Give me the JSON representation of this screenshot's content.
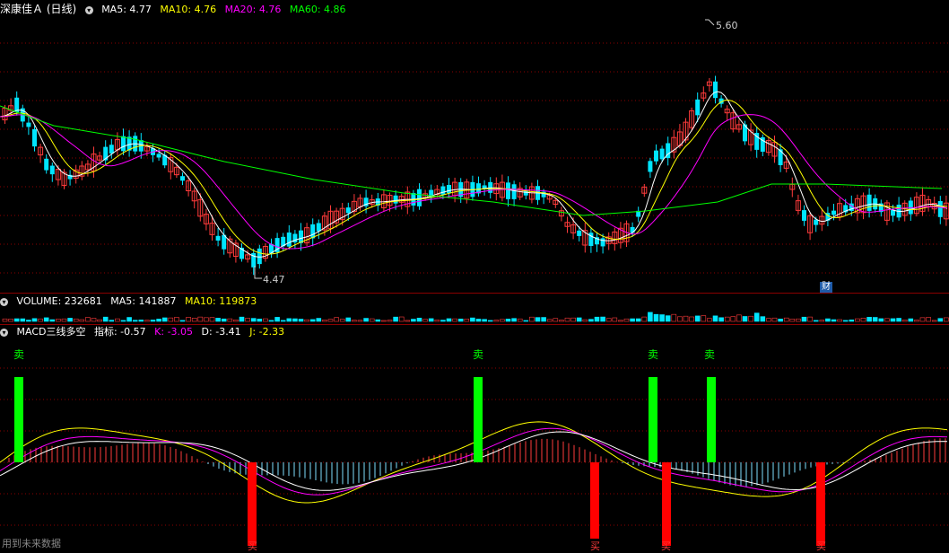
{
  "main_header": {
    "title": "深康佳Ａ (日线)",
    "ma5": "MA5: 4.77",
    "ma10": "MA10: 4.76",
    "ma20": "MA20: 4.76",
    "ma60": "MA60: 4.86"
  },
  "price_labels": {
    "high": "5.60",
    "low": "4.47",
    "finance_marker": "财"
  },
  "volume_header": {
    "title": "VOLUME: 232681",
    "ma5": "MA5: 141887",
    "ma10": "MA10: 119873"
  },
  "indicator_header": {
    "title": "MACD三线多空",
    "zhibiao": "指标: -0.57",
    "k": "K: -3.05",
    "d": "D: -3.41",
    "j": "J: -2.33"
  },
  "signals": {
    "sell": "卖",
    "buy": "买"
  },
  "footer": "用到未来数据",
  "colors": {
    "up": "#ff3b3b",
    "down": "#00e5ff",
    "ma5": "#ffffff",
    "ma10": "#ffff00",
    "ma20": "#ff00ff",
    "ma60": "#00ff00",
    "sell_bar": "#00ff00",
    "buy_bar": "#ff0000",
    "grid": "#8b0000"
  }
}
